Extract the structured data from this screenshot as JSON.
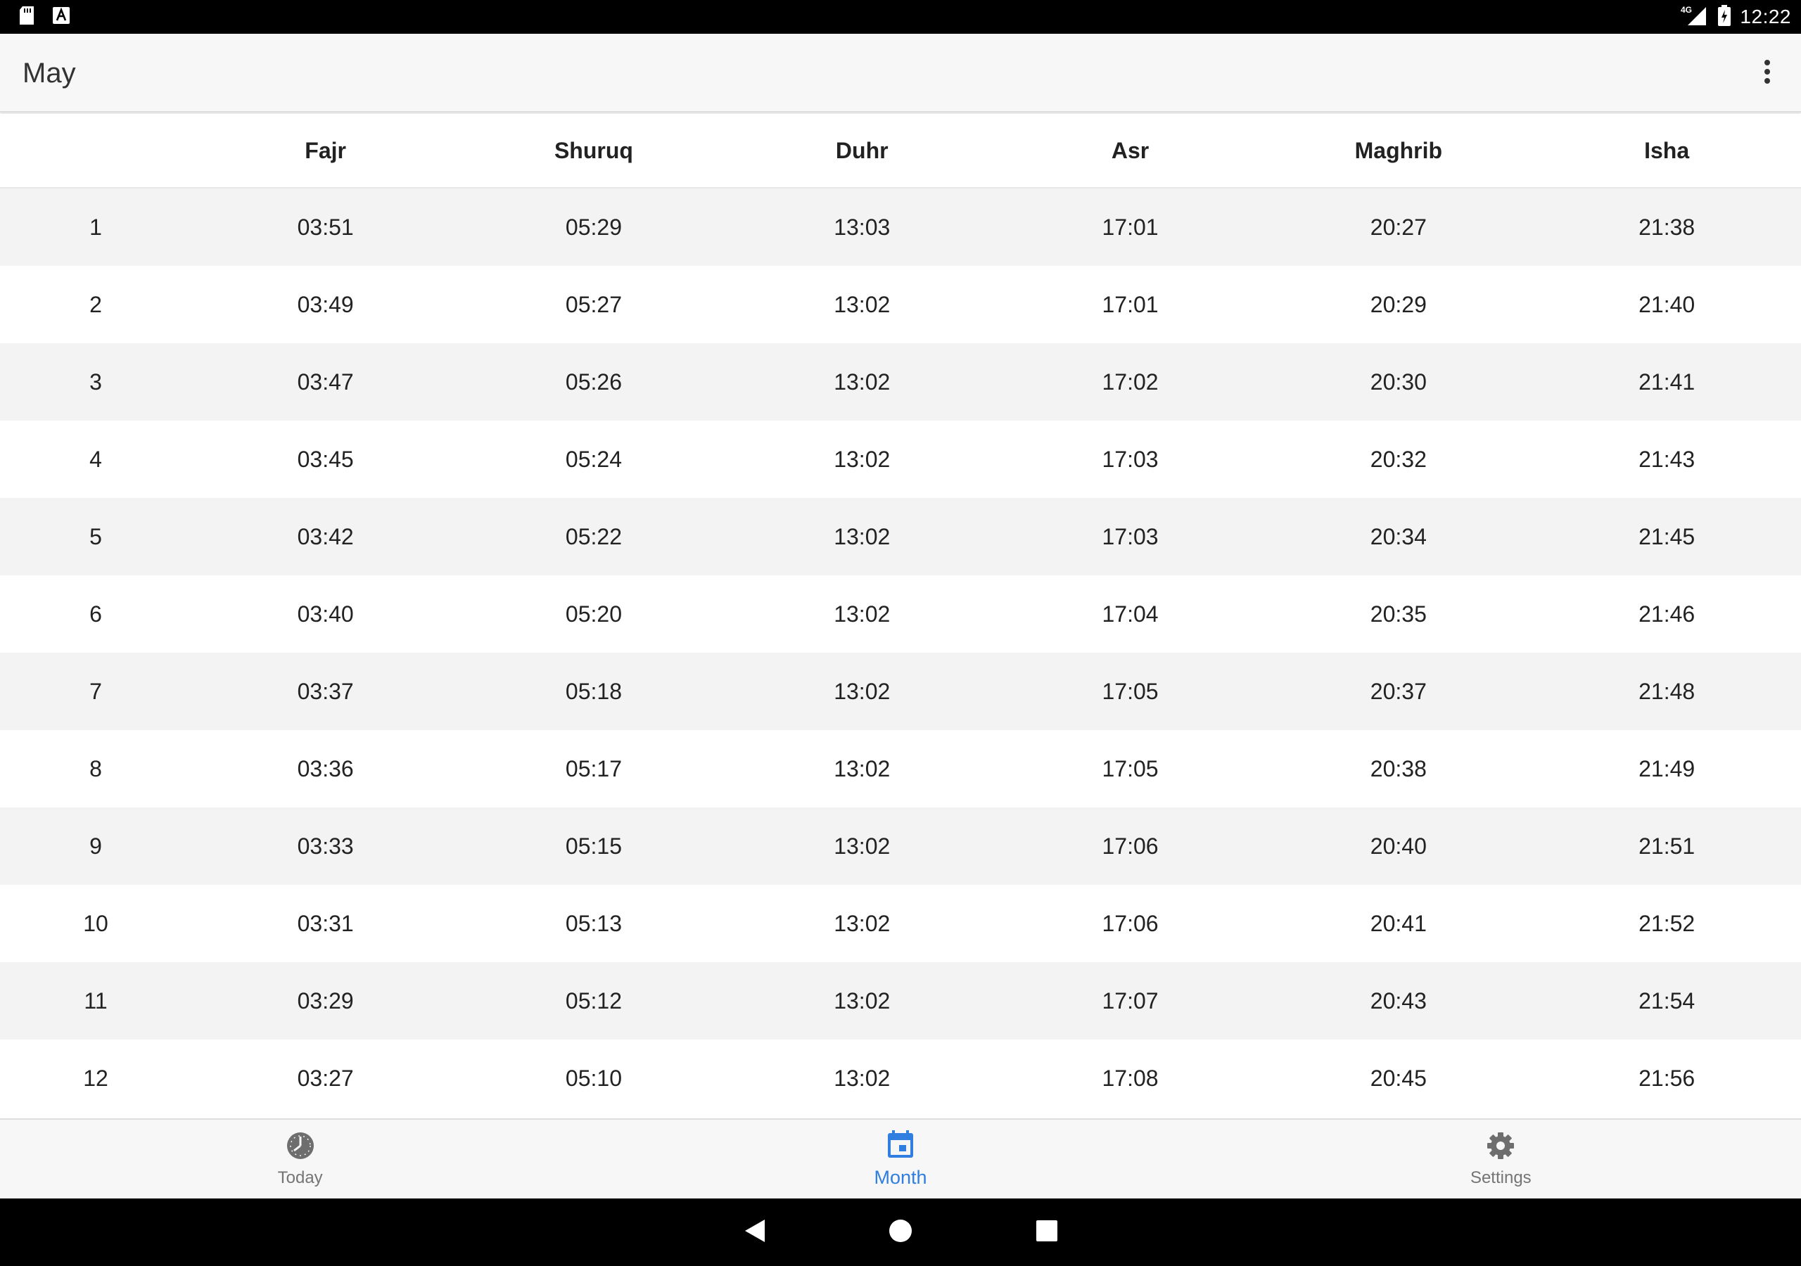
{
  "status_bar": {
    "time": "12:22",
    "network": "4G",
    "icons": [
      "sd-card-icon",
      "text-a-icon",
      "signal-icon",
      "battery-icon"
    ]
  },
  "app_bar": {
    "title": "May",
    "overflow_icon": "more-vert-icon"
  },
  "table": {
    "columns": [
      "",
      "Fajr",
      "Shuruq",
      "Duhr",
      "Asr",
      "Maghrib",
      "Isha"
    ],
    "rows": [
      [
        "1",
        "03:51",
        "05:29",
        "13:03",
        "17:01",
        "20:27",
        "21:38"
      ],
      [
        "2",
        "03:49",
        "05:27",
        "13:02",
        "17:01",
        "20:29",
        "21:40"
      ],
      [
        "3",
        "03:47",
        "05:26",
        "13:02",
        "17:02",
        "20:30",
        "21:41"
      ],
      [
        "4",
        "03:45",
        "05:24",
        "13:02",
        "17:03",
        "20:32",
        "21:43"
      ],
      [
        "5",
        "03:42",
        "05:22",
        "13:02",
        "17:03",
        "20:34",
        "21:45"
      ],
      [
        "6",
        "03:40",
        "05:20",
        "13:02",
        "17:04",
        "20:35",
        "21:46"
      ],
      [
        "7",
        "03:37",
        "05:18",
        "13:02",
        "17:05",
        "20:37",
        "21:48"
      ],
      [
        "8",
        "03:36",
        "05:17",
        "13:02",
        "17:05",
        "20:38",
        "21:49"
      ],
      [
        "9",
        "03:33",
        "05:15",
        "13:02",
        "17:06",
        "20:40",
        "21:51"
      ],
      [
        "10",
        "03:31",
        "05:13",
        "13:02",
        "17:06",
        "20:41",
        "21:52"
      ],
      [
        "11",
        "03:29",
        "05:12",
        "13:02",
        "17:07",
        "20:43",
        "21:54"
      ],
      [
        "12",
        "03:27",
        "05:10",
        "13:02",
        "17:08",
        "20:45",
        "21:56"
      ]
    ]
  },
  "bottom_nav": {
    "items": [
      {
        "label": "Today",
        "icon": "clock-icon",
        "active": false
      },
      {
        "label": "Month",
        "icon": "calendar-icon",
        "active": true
      },
      {
        "label": "Settings",
        "icon": "gear-icon",
        "active": false
      }
    ]
  },
  "system_nav": {
    "buttons": [
      "back-icon",
      "home-icon",
      "recents-icon"
    ]
  },
  "colors": {
    "accent": "#2f7ee0",
    "inactive": "#757575",
    "row_alt": "#f3f3f3",
    "bar_bg": "#f7f7f7"
  }
}
